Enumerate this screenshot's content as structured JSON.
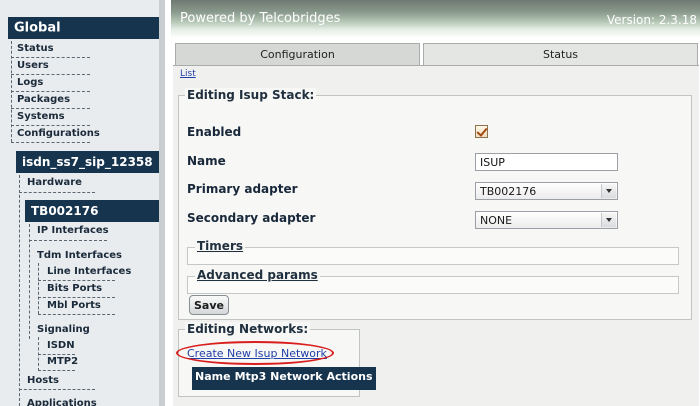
{
  "sidebar": {
    "global_title": "Global",
    "global_items": [
      "Status",
      "Users",
      "Logs",
      "Packages",
      "Systems",
      "Configurations"
    ],
    "device_title": "isdn_ss7_sip_12358",
    "hardware": "Hardware",
    "adapter_title": "TB002176",
    "ip_interfaces": "IP Interfaces",
    "tdm_interfaces": "Tdm Interfaces",
    "tdm_items": [
      "Line Interfaces",
      "Bits Ports",
      "Mbl Ports"
    ],
    "signaling": "Signaling",
    "signaling_items": [
      "ISDN",
      "MTP2"
    ],
    "hosts": "Hosts",
    "applications": "Applications"
  },
  "banner": {
    "title": "Powered by Telcobridges",
    "version": "Version: 2.3.18"
  },
  "tabs": {
    "configuration": "Configuration",
    "status": "Status"
  },
  "list_link": "List",
  "stack_form": {
    "legend": "Editing Isup Stack:",
    "enabled_label": "Enabled",
    "enabled": true,
    "name_label": "Name",
    "name_value": "ISUP",
    "primary_label": "Primary adapter",
    "primary_value": "TB002176",
    "secondary_label": "Secondary adapter",
    "secondary_value": "NONE",
    "timers": "Timers",
    "advanced": "Advanced params",
    "save": "Save"
  },
  "networks": {
    "legend": "Editing Networks:",
    "create_link": "Create New Isup Network",
    "columns": [
      "Name",
      "Mtp3 Network",
      "Actions"
    ]
  },
  "colors": {
    "nav_header": "#17344f",
    "highlight": "#d91e1e",
    "link": "#1f3fa8"
  }
}
